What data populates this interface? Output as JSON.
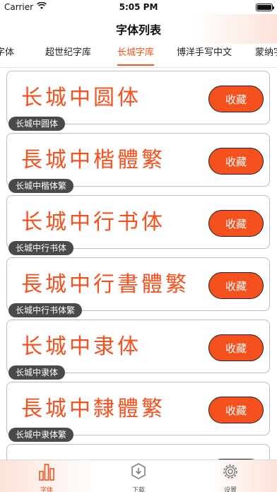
{
  "status": {
    "carrier": "Carrier",
    "time": "5:05 PM"
  },
  "nav": {
    "title": "字体列表"
  },
  "tabs": [
    {
      "label": "字体",
      "active": false
    },
    {
      "label": "超世纪字库",
      "active": false
    },
    {
      "label": "长城字库",
      "active": true
    },
    {
      "label": "博洋手写中文",
      "active": false
    },
    {
      "label": "蒙纳字",
      "active": false
    }
  ],
  "fonts": [
    {
      "preview": "长城中圆体",
      "name": "长城中圆体",
      "action": "收藏"
    },
    {
      "preview": "長城中楷體繁",
      "name": "长城中楷体繁",
      "action": "收藏"
    },
    {
      "preview": "长城中行书体",
      "name": "长城中行书体",
      "action": "收藏"
    },
    {
      "preview": "長城中行書體繁",
      "name": "长城中行书体繁",
      "action": "收藏"
    },
    {
      "preview": "长城中隶体",
      "name": "长城中隶体",
      "action": "收藏"
    },
    {
      "preview": "長城中隸體繁",
      "name": "长城中隶体繁",
      "action": "收藏"
    }
  ],
  "tabbar": [
    {
      "label": "字体",
      "icon": "bar-chart-icon",
      "active": true
    },
    {
      "label": "下载",
      "icon": "download-icon",
      "active": false
    },
    {
      "label": "设置",
      "icon": "gear-icon",
      "active": false
    }
  ],
  "colors": {
    "accent": "#f4511e",
    "label_bg": "#4a4a4a"
  }
}
